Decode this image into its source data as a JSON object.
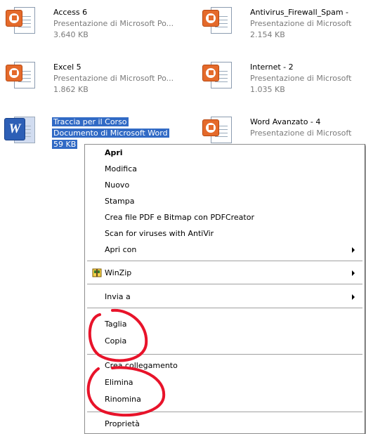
{
  "files": [
    {
      "name": "Access 6",
      "type": "Presentazione di Microsoft Po...",
      "size": "3.640 KB"
    },
    {
      "name": "Antivirus_Firewall_Spam -",
      "type": "Presentazione di Microsoft",
      "size": "2.154 KB"
    },
    {
      "name": "Excel 5",
      "type": "Presentazione di Microsoft Po...",
      "size": "1.862 KB"
    },
    {
      "name": "Internet - 2",
      "type": "Presentazione di Microsoft",
      "size": "1.035 KB"
    },
    {
      "name": "Traccia per il Corso",
      "type": "Documento di Microsoft Word",
      "size": "59 KB"
    },
    {
      "name": "Word Avanzato - 4",
      "type": "Presentazione di Microsoft",
      "size": ""
    }
  ],
  "menu": {
    "items": [
      {
        "label": "Apri"
      },
      {
        "label": "Modifica"
      },
      {
        "label": "Nuovo"
      },
      {
        "label": "Stampa"
      },
      {
        "label": "Crea file PDF e Bitmap con PDFCreator"
      },
      {
        "label": "Scan for viruses with AntiVir"
      },
      {
        "label": "Apri con"
      },
      {
        "label": "WinZip"
      },
      {
        "label": "Invia a"
      },
      {
        "label": "Taglia"
      },
      {
        "label": "Copia"
      },
      {
        "label": "Crea collegamento"
      },
      {
        "label": "Elimina"
      },
      {
        "label": "Rinomina"
      },
      {
        "label": "Proprietà"
      }
    ]
  },
  "colors": {
    "selection": "#316ac5",
    "annotation": "#e8132a",
    "ppt": "#e46a2b",
    "word": "#2d5fb6"
  },
  "icons": {
    "ppt": "powerpoint-file-icon",
    "doc": "word-file-icon",
    "winzip": "winzip-icon",
    "submenu": "submenu-arrow-icon"
  }
}
